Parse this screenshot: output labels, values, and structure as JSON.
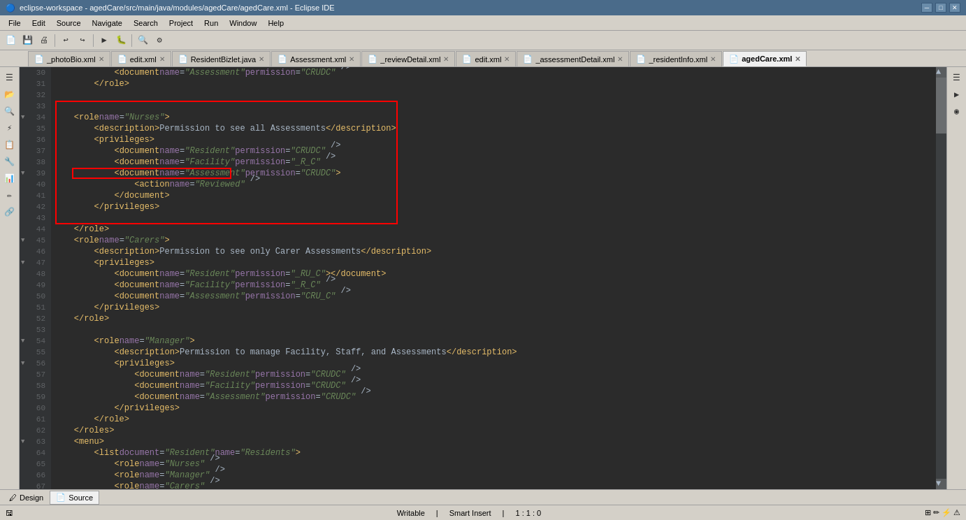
{
  "titleBar": {
    "title": "eclipse-workspace - agedCare/src/main/java/modules/agedCare/agedCare.xml - Eclipse IDE",
    "icon": "🔵"
  },
  "menuBar": {
    "items": [
      "File",
      "Edit",
      "Source",
      "Navigate",
      "Search",
      "Project",
      "Run",
      "Window",
      "Help"
    ]
  },
  "tabs": [
    {
      "label": "_photoBio.xml",
      "active": false,
      "icon": "📄"
    },
    {
      "label": "edit.xml",
      "active": false,
      "icon": "📄"
    },
    {
      "label": "ResidentBizlet.java",
      "active": false,
      "icon": "📄"
    },
    {
      "label": "Assessment.xml",
      "active": false,
      "icon": "📄"
    },
    {
      "label": "_reviewDetail.xml",
      "active": false,
      "icon": "📄"
    },
    {
      "label": "edit.xml",
      "active": false,
      "icon": "📄"
    },
    {
      "label": "_assessmentDetail.xml",
      "active": false,
      "icon": "📄"
    },
    {
      "label": "_residentInfo.xml",
      "active": false,
      "icon": "📄"
    },
    {
      "label": "agedCare.xml",
      "active": true,
      "icon": "📄"
    }
  ],
  "codeLines": [
    {
      "num": 30,
      "indent": 3,
      "content": "<document name=\"Assessment\" permission=\"CRUDC\" />",
      "fold": false
    },
    {
      "num": 31,
      "indent": 2,
      "content": "</role>",
      "fold": false
    },
    {
      "num": 32,
      "indent": 0,
      "content": "",
      "fold": false
    },
    {
      "num": 33,
      "indent": 0,
      "content": "",
      "fold": false
    },
    {
      "num": 34,
      "indent": 1,
      "content": "<role name=\"Nurses\">",
      "fold": true,
      "highlight": true
    },
    {
      "num": 35,
      "indent": 2,
      "content": "<description>Permission to see all Assessments</description>",
      "fold": false
    },
    {
      "num": 36,
      "indent": 2,
      "content": "<privileges>",
      "fold": false
    },
    {
      "num": 37,
      "indent": 3,
      "content": "<document name=\"Resident\" permission=\"CRUDC\" />",
      "fold": false
    },
    {
      "num": 38,
      "indent": 3,
      "content": "<document name=\"Facility\" permission=\"_R_C\" />",
      "fold": false
    },
    {
      "num": 39,
      "indent": 3,
      "content": "<document name=\"Assessment\" permission=\"CRUDC\">",
      "fold": true
    },
    {
      "num": 40,
      "indent": 4,
      "content": "<action name=\"Reviewed\" />",
      "fold": false,
      "actionHighlight": true
    },
    {
      "num": 41,
      "indent": 3,
      "content": "</document>",
      "fold": false
    },
    {
      "num": 42,
      "indent": 2,
      "content": "</privileges>",
      "fold": false
    },
    {
      "num": 43,
      "indent": 0,
      "content": "",
      "fold": false
    },
    {
      "num": 44,
      "indent": 1,
      "content": "</role>",
      "fold": false
    },
    {
      "num": 45,
      "indent": 1,
      "content": "<role name=\"Carers\">",
      "fold": true
    },
    {
      "num": 46,
      "indent": 2,
      "content": "<description>Permission to see only Carer Assessments</description>",
      "fold": false
    },
    {
      "num": 47,
      "indent": 2,
      "content": "<privileges>",
      "fold": true
    },
    {
      "num": 48,
      "indent": 3,
      "content": "<document name=\"Resident\" permission=\"_RU_C\"></document>",
      "fold": false
    },
    {
      "num": 49,
      "indent": 3,
      "content": "<document name=\"Facility\" permission=\"_R_C\" />",
      "fold": false
    },
    {
      "num": 50,
      "indent": 3,
      "content": "<document name=\"Assessment\" permission=\"CRU_C\" />",
      "fold": false
    },
    {
      "num": 51,
      "indent": 2,
      "content": "</privileges>",
      "fold": false
    },
    {
      "num": 52,
      "indent": 1,
      "content": "</role>",
      "fold": false
    },
    {
      "num": 53,
      "indent": 0,
      "content": "",
      "fold": false
    },
    {
      "num": 54,
      "indent": 1,
      "content": "<role name=\"Manager\">",
      "fold": true
    },
    {
      "num": 55,
      "indent": 2,
      "content": "<description>Permission to manage Facility, Staff, and Assessments</description>",
      "fold": false
    },
    {
      "num": 56,
      "indent": 2,
      "content": "<privileges>",
      "fold": true
    },
    {
      "num": 57,
      "indent": 3,
      "content": "<document name=\"Resident\" permission=\"CRUDC\" />",
      "fold": false
    },
    {
      "num": 58,
      "indent": 3,
      "content": "<document name=\"Facility\" permission=\"CRUDC\" />",
      "fold": false
    },
    {
      "num": 59,
      "indent": 3,
      "content": "<document name=\"Assessment\" permission=\"CRUDC\" />",
      "fold": false
    },
    {
      "num": 60,
      "indent": 2,
      "content": "</privileges>",
      "fold": false
    },
    {
      "num": 61,
      "indent": 1,
      "content": "</role>",
      "fold": false
    },
    {
      "num": 62,
      "indent": 0,
      "content": "</roles>",
      "fold": false
    },
    {
      "num": 63,
      "indent": 0,
      "content": "<menu>",
      "fold": true
    },
    {
      "num": 64,
      "indent": 1,
      "content": "<list document=\"Resident\" name=\"Residents\">",
      "fold": false
    },
    {
      "num": 65,
      "indent": 2,
      "content": "<role name=\"Nurses\" />",
      "fold": false
    },
    {
      "num": 66,
      "indent": 2,
      "content": "<role name=\"Manager\" />",
      "fold": false
    },
    {
      "num": 67,
      "indent": 2,
      "content": "<role name=\"Carers\" />",
      "fold": false
    }
  ],
  "bottomTabs": [
    {
      "label": "Design",
      "icon": "🖊",
      "active": false
    },
    {
      "label": "Source",
      "icon": "📄",
      "active": true
    }
  ],
  "statusBar": {
    "mode": "Writable",
    "insertMode": "Smart Insert",
    "position": "1 : 1 : 0"
  }
}
